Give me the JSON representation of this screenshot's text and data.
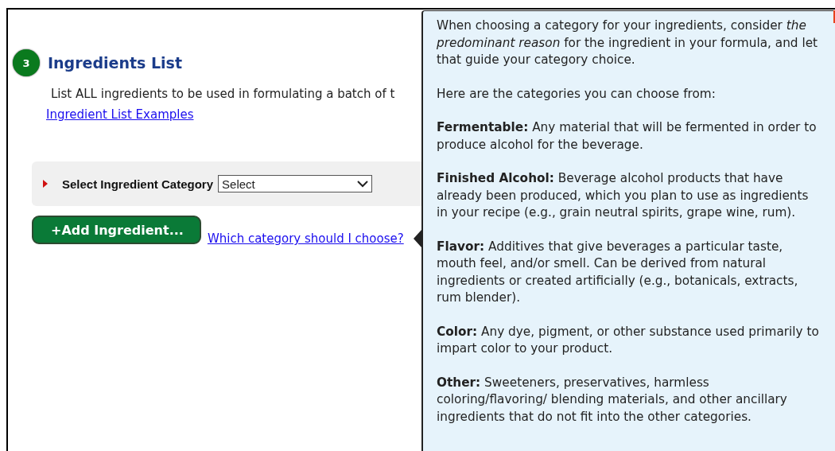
{
  "section": {
    "step": "3",
    "title": "Ingredients List",
    "description": "List ALL ingredients to be used in formulating a batch of t",
    "examples_link": "Ingredient List Examples"
  },
  "category_selector": {
    "label": "Select Ingredient Category",
    "value": "Select"
  },
  "add_button": "+Add Ingredient...",
  "help_link": "Which category should I choose?",
  "popup": {
    "paragraphs": [
      "When choosing a category for your ingredients, consider *the predominant reason* for the ingredient in your formula, and let that guide your category choice.",
      "Here are the categories you can choose from:",
      "**Fermentable:** Any material that will be fermented in order to produce alcohol for the beverage.",
      "**Finished Alcohol:** Beverage alcohol products that have already been produced, which you plan to use as ingredients in your recipe (e.g., grain neutral spirits, grape wine, rum).",
      "**Flavor:** Additives that give beverages a particular taste, mouth feel, and/or smell. Can be derived from natural ingredients or created artificially (e.g., botanicals, extracts, rum blender).",
      "**Color:** Any dye, pigment, or other substance used primarily to impart color to your product.",
      "**Other:** Sweeteners, preservatives, harmless coloring/flavoring/ blending materials, and other ancillary ingredients that do not fit into the other categories."
    ]
  }
}
